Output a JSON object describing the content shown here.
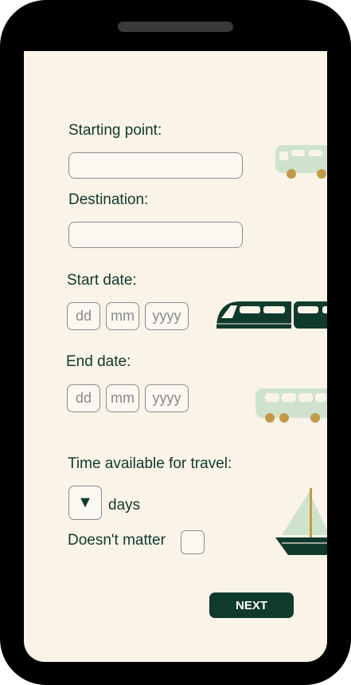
{
  "form": {
    "starting_point_label": "Starting point:",
    "starting_point_value": "",
    "destination_label": "Destination:",
    "destination_value": "",
    "start_date_label": "Start date:",
    "end_date_label": "End date:",
    "date_placeholders": {
      "day": "dd",
      "month": "mm",
      "year": "yyyy"
    },
    "time_available_label": "Time available for travel:",
    "days_unit": "days",
    "doesnt_matter_label": "Doesn't matter",
    "doesnt_matter_checked": false,
    "next_label": "NEXT"
  },
  "icons": {
    "dropdown": "▼",
    "decorations": [
      "bus-icon",
      "train-icon",
      "bus-icon",
      "sailboat-icon"
    ]
  },
  "colors": {
    "background": "#faf3e8",
    "primary": "#0f3a2c",
    "bus_body": "#cfe3cc",
    "wheel": "#c39a4a",
    "sail": "#cfe3cc"
  }
}
